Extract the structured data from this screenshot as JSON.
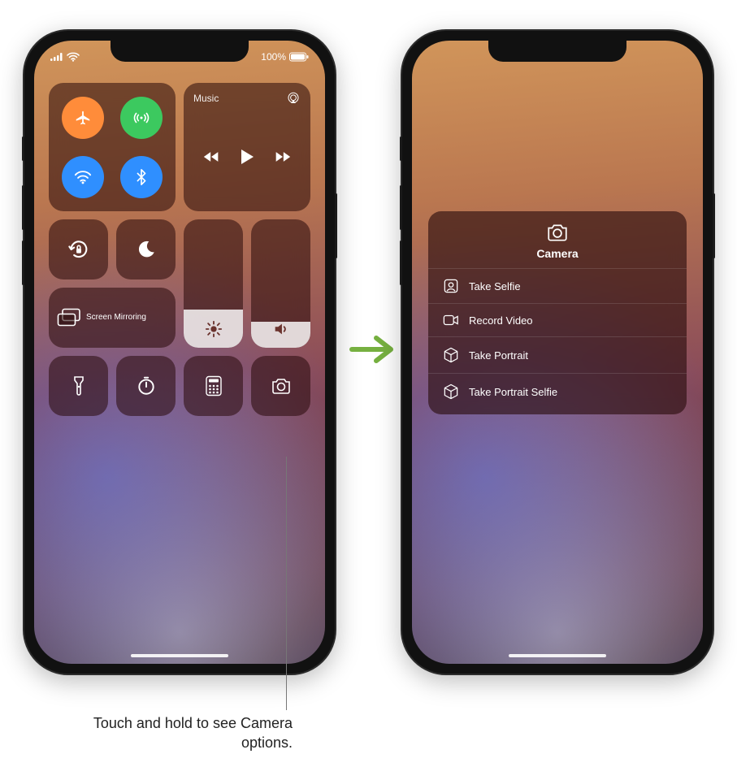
{
  "status": {
    "battery_pct": "100%"
  },
  "control_center": {
    "music_label": "Music",
    "screen_mirroring_label": "Screen Mirroring",
    "brightness_level": 0.3,
    "volume_level": 0.2
  },
  "camera_menu": {
    "title": "Camera",
    "items": [
      {
        "icon": "selfie-icon",
        "label": "Take Selfie"
      },
      {
        "icon": "video-icon",
        "label": "Record Video"
      },
      {
        "icon": "cube-icon",
        "label": "Take Portrait"
      },
      {
        "icon": "cube-icon",
        "label": "Take Portrait Selfie"
      }
    ]
  },
  "callout": {
    "text": "Touch and hold to see Camera options."
  }
}
